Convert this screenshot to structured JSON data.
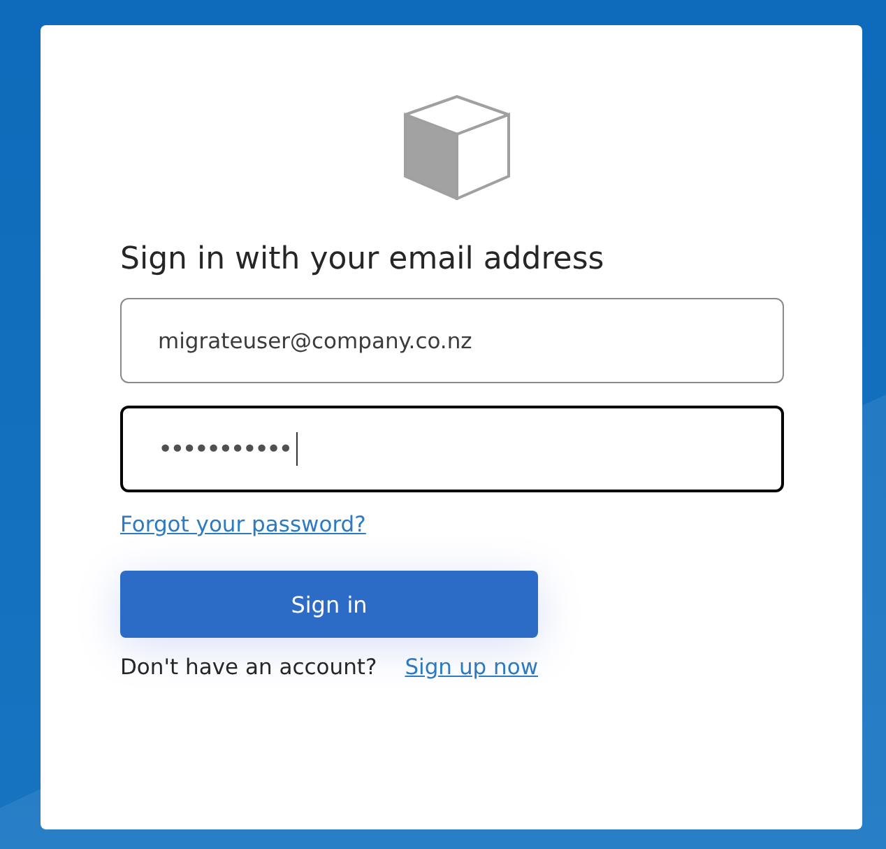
{
  "title": "Sign in with your email address",
  "fields": [
    {
      "kind": "email",
      "value": "migrateuser@company.co.nz",
      "focused": false
    },
    {
      "kind": "password",
      "value": "•••••••••••",
      "focused": true
    }
  ],
  "forgot_link": "Forgot your password?",
  "submit_button": "Sign in",
  "signup": {
    "prompt": "Don't have an account?",
    "link": "Sign up now"
  }
}
